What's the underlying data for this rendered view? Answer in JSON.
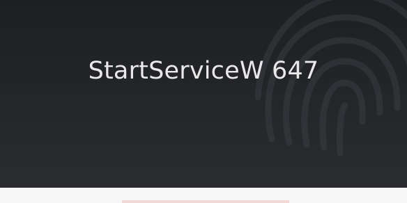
{
  "dialog": {
    "message": "StartServiceW 647"
  },
  "icons": {
    "background": "fingerprint-watermark-icon"
  },
  "colors": {
    "background_top": "#1d1f22",
    "background_bottom": "#2a2c30",
    "text": "#e9e9e9",
    "footer": "#f6f6f6"
  }
}
